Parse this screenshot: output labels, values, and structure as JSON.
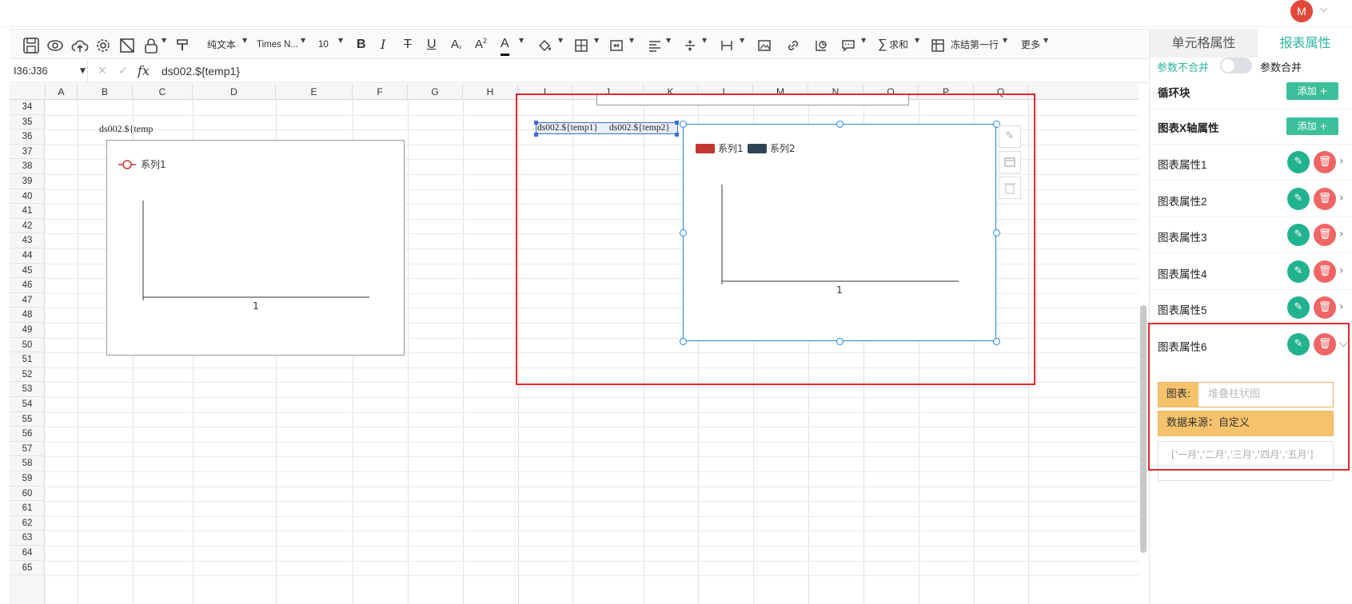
{
  "user": {
    "avatar_letter": "M"
  },
  "toolbar": {
    "text_format": "纯文本",
    "font_family": "Times N...",
    "font_size": "10",
    "sum": "求和",
    "freeze": "冻结第一行",
    "more": "更多"
  },
  "formula_bar": {
    "name_box": "I36:J36",
    "fx": "fx",
    "formula": "ds002.${temp1}"
  },
  "sheet": {
    "columns": [
      "A",
      "B",
      "C",
      "D",
      "E",
      "F",
      "G",
      "H",
      "I",
      "J",
      "K",
      "L",
      "M",
      "N",
      "O",
      "P",
      "Q"
    ],
    "rows": [
      "34",
      "35",
      "36",
      "37",
      "38",
      "39",
      "40",
      "41",
      "42",
      "43",
      "44",
      "45",
      "46",
      "47",
      "48",
      "49",
      "50",
      "51",
      "52",
      "53",
      "54",
      "55",
      "56",
      "57",
      "58",
      "59",
      "60",
      "61",
      "62",
      "63",
      "64",
      "65"
    ],
    "cell_b36": "ds002.${temp",
    "cell_i36": "ds002.${temp1}",
    "cell_j36": "ds002.${temp2}"
  },
  "chart_left": {
    "legend": "系列1",
    "x_tick": "1",
    "series_color": "#c23531"
  },
  "chart_right": {
    "legend": [
      "系列1",
      "系列2"
    ],
    "x_tick": "1",
    "series_colors": [
      "#c23531",
      "#2f4554"
    ]
  },
  "panel": {
    "tab_cell": "单元格属性",
    "tab_report": "报表属性",
    "param_no_merge": "参数不合并",
    "param_merge": "参数合并",
    "loop_block": "循环块",
    "add": "添加 +",
    "x_axis": "图表X轴属性",
    "chart_props": [
      "图表属性1",
      "图表属性2",
      "图表属性3",
      "图表属性4",
      "图表属性5",
      "图表属性6"
    ],
    "chart_label": "图表:",
    "chart_value": "堆叠柱状图",
    "data_source": "数据来源：自定义",
    "data_value": "['一月','二月','三月','四月','五月']"
  }
}
